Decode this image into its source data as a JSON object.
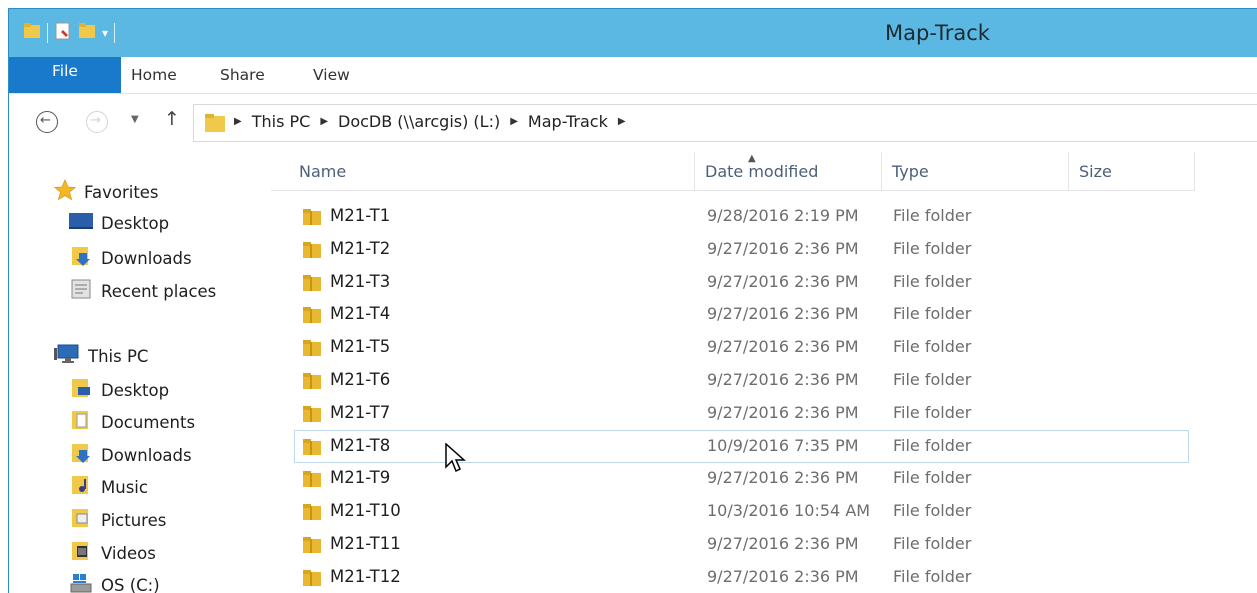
{
  "window": {
    "title": "Map-Track"
  },
  "ribbon": {
    "tabs": {
      "file": "File",
      "home": "Home",
      "share": "Share",
      "view": "View"
    }
  },
  "address": {
    "crumbs": [
      "This PC",
      "DocDB (\\\\arcgis) (L:)",
      "Map-Track"
    ]
  },
  "nav": {
    "favorites": {
      "label": "Favorites",
      "items": [
        "Desktop",
        "Downloads",
        "Recent places"
      ]
    },
    "this_pc": {
      "label": "This PC",
      "items": [
        "Desktop",
        "Documents",
        "Downloads",
        "Music",
        "Pictures",
        "Videos",
        "OS (C:)"
      ]
    }
  },
  "columns": {
    "name": "Name",
    "date": "Date modified",
    "type": "Type",
    "size": "Size"
  },
  "files": [
    {
      "name": "M21-T1",
      "date": "9/28/2016 2:19 PM",
      "type": "File folder"
    },
    {
      "name": "M21-T2",
      "date": "9/27/2016 2:36 PM",
      "type": "File folder"
    },
    {
      "name": "M21-T3",
      "date": "9/27/2016 2:36 PM",
      "type": "File folder"
    },
    {
      "name": "M21-T4",
      "date": "9/27/2016 2:36 PM",
      "type": "File folder"
    },
    {
      "name": "M21-T5",
      "date": "9/27/2016 2:36 PM",
      "type": "File folder"
    },
    {
      "name": "M21-T6",
      "date": "9/27/2016 2:36 PM",
      "type": "File folder"
    },
    {
      "name": "M21-T7",
      "date": "9/27/2016 2:36 PM",
      "type": "File folder"
    },
    {
      "name": "M21-T8",
      "date": "10/9/2016 7:35 PM",
      "type": "File folder"
    },
    {
      "name": "M21-T9",
      "date": "9/27/2016 2:36 PM",
      "type": "File folder"
    },
    {
      "name": "M21-T10",
      "date": "10/3/2016 10:54 AM",
      "type": "File folder"
    },
    {
      "name": "M21-T11",
      "date": "9/27/2016 2:36 PM",
      "type": "File folder"
    },
    {
      "name": "M21-T12",
      "date": "9/27/2016 2:36 PM",
      "type": "File folder"
    }
  ],
  "colors": {
    "titlebar": "#5bb8e2",
    "file_tab": "#1979ca",
    "folder": "#e8b830"
  }
}
